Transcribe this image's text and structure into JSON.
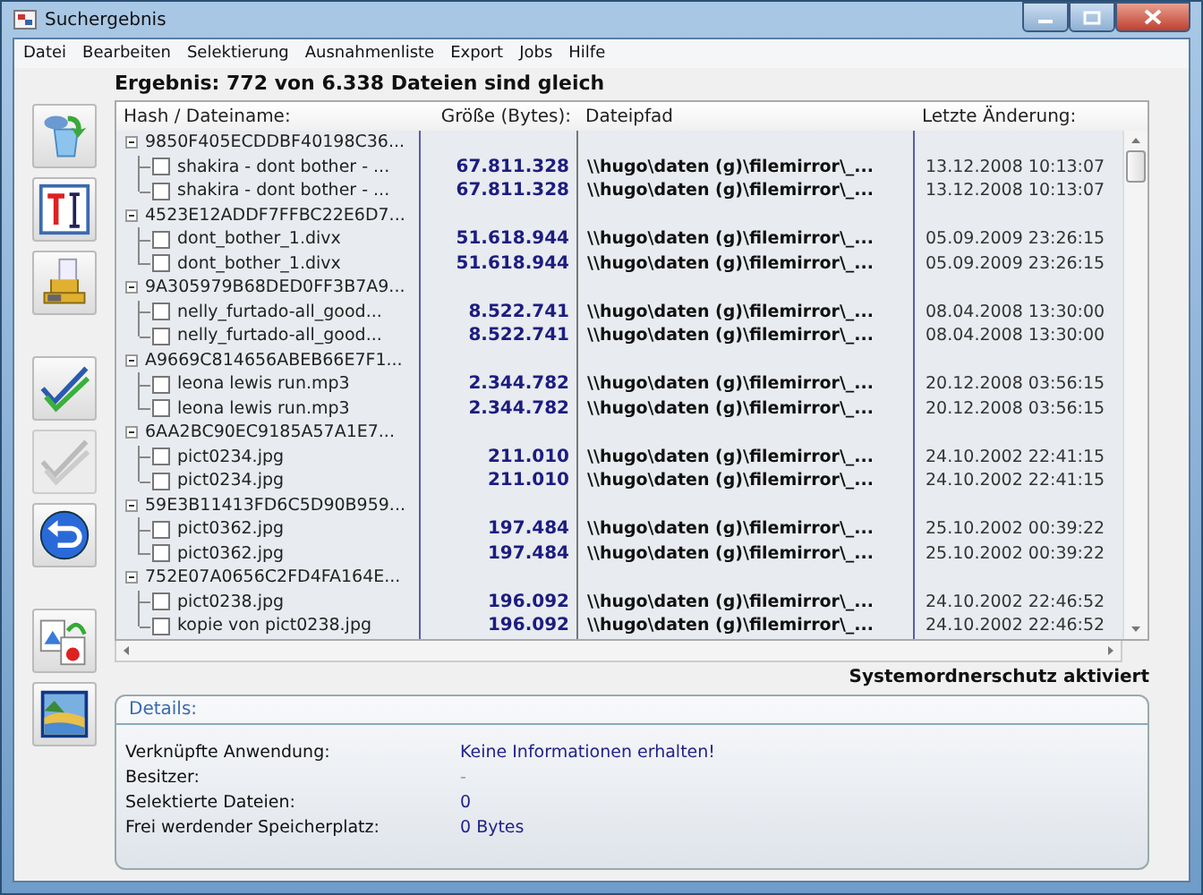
{
  "window": {
    "title": "Suchergebnis"
  },
  "menu": [
    "Datei",
    "Bearbeiten",
    "Selektierung",
    "Ausnahmenliste",
    "Export",
    "Jobs",
    "Hilfe"
  ],
  "result": "Ergebnis: 772 von 6.338 Dateien sind gleich",
  "toolbar": [
    {
      "kind": "recycle",
      "disabled": false
    },
    {
      "kind": "text",
      "disabled": false
    },
    {
      "kind": "archive",
      "disabled": false
    },
    {
      "kind": "check",
      "disabled": false
    },
    {
      "kind": "check",
      "disabled": true
    },
    {
      "kind": "undo",
      "disabled": false
    },
    {
      "kind": "restore",
      "disabled": false
    },
    {
      "kind": "image",
      "disabled": false
    }
  ],
  "table": {
    "columns": [
      "Hash / Dateiname:",
      "Größe (Bytes):",
      "Dateipfad",
      "Letzte Änderung:"
    ],
    "groups": [
      {
        "hash": "9850F405ECDDBF40198C36...",
        "expanded": true,
        "files": [
          {
            "name": "shakira - dont bother - ...",
            "checked": false,
            "size": "67.811.328",
            "path": "\\\\hugo\\daten (g)\\filemirror\\_...",
            "modified": "13.12.2008 10:13:07"
          },
          {
            "name": "shakira - dont bother - ...",
            "checked": false,
            "size": "67.811.328",
            "path": "\\\\hugo\\daten (g)\\filemirror\\_...",
            "modified": "13.12.2008 10:13:07"
          }
        ]
      },
      {
        "hash": "4523E12ADDF7FFBC22E6D7...",
        "expanded": true,
        "files": [
          {
            "name": "dont_bother_1.divx",
            "checked": false,
            "size": "51.618.944",
            "path": "\\\\hugo\\daten (g)\\filemirror\\_...",
            "modified": "05.09.2009 23:26:15"
          },
          {
            "name": "dont_bother_1.divx",
            "checked": false,
            "size": "51.618.944",
            "path": "\\\\hugo\\daten (g)\\filemirror\\_...",
            "modified": "05.09.2009 23:26:15"
          }
        ]
      },
      {
        "hash": "9A305979B68DED0FF3B7A9...",
        "expanded": true,
        "files": [
          {
            "name": "nelly_furtado-all_good...",
            "checked": false,
            "size": "8.522.741",
            "path": "\\\\hugo\\daten (g)\\filemirror\\_...",
            "modified": "08.04.2008 13:30:00"
          },
          {
            "name": "nelly_furtado-all_good...",
            "checked": false,
            "size": "8.522.741",
            "path": "\\\\hugo\\daten (g)\\filemirror\\_...",
            "modified": "08.04.2008 13:30:00"
          }
        ]
      },
      {
        "hash": "A9669C814656ABEB66E7F1...",
        "expanded": true,
        "files": [
          {
            "name": "leona lewis run.mp3",
            "checked": false,
            "size": "2.344.782",
            "path": "\\\\hugo\\daten (g)\\filemirror\\_...",
            "modified": "20.12.2008 03:56:15"
          },
          {
            "name": "leona lewis run.mp3",
            "checked": false,
            "size": "2.344.782",
            "path": "\\\\hugo\\daten (g)\\filemirror\\_...",
            "modified": "20.12.2008 03:56:15"
          }
        ]
      },
      {
        "hash": "6AA2BC90EC9185A57A1E7...",
        "expanded": true,
        "files": [
          {
            "name": "pict0234.jpg",
            "checked": false,
            "size": "211.010",
            "path": "\\\\hugo\\daten (g)\\filemirror\\_...",
            "modified": "24.10.2002 22:41:15"
          },
          {
            "name": "pict0234.jpg",
            "checked": false,
            "size": "211.010",
            "path": "\\\\hugo\\daten (g)\\filemirror\\_...",
            "modified": "24.10.2002 22:41:15"
          }
        ]
      },
      {
        "hash": "59E3B11413FD6C5D90B959...",
        "expanded": true,
        "files": [
          {
            "name": "pict0362.jpg",
            "checked": false,
            "size": "197.484",
            "path": "\\\\hugo\\daten (g)\\filemirror\\_...",
            "modified": "25.10.2002 00:39:22"
          },
          {
            "name": "pict0362.jpg",
            "checked": false,
            "size": "197.484",
            "path": "\\\\hugo\\daten (g)\\filemirror\\_...",
            "modified": "25.10.2002 00:39:22"
          }
        ]
      },
      {
        "hash": "752E07A0656C2FD4FA164E...",
        "expanded": true,
        "files": [
          {
            "name": "pict0238.jpg",
            "checked": false,
            "size": "196.092",
            "path": "\\\\hugo\\daten (g)\\filemirror\\_...",
            "modified": "24.10.2002 22:46:52"
          },
          {
            "name": "kopie von pict0238.jpg",
            "checked": false,
            "size": "196.092",
            "path": "\\\\hugo\\daten (g)\\filemirror\\_...",
            "modified": "24.10.2002 22:46:52"
          }
        ]
      }
    ]
  },
  "protection": "Systemordnerschutz aktiviert",
  "details": {
    "title": "Details:",
    "fields": [
      {
        "label": "Verknüpfte Anwendung:",
        "value": "Keine Informationen erhalten!",
        "dimmed": false
      },
      {
        "label": "Besitzer:",
        "value": "-",
        "dimmed": true
      },
      {
        "label": "Selektierte Dateien:",
        "value": "0",
        "dimmed": false
      },
      {
        "label": "Frei werdender Speicherplatz:",
        "value": "0 Bytes",
        "dimmed": false
      }
    ]
  }
}
